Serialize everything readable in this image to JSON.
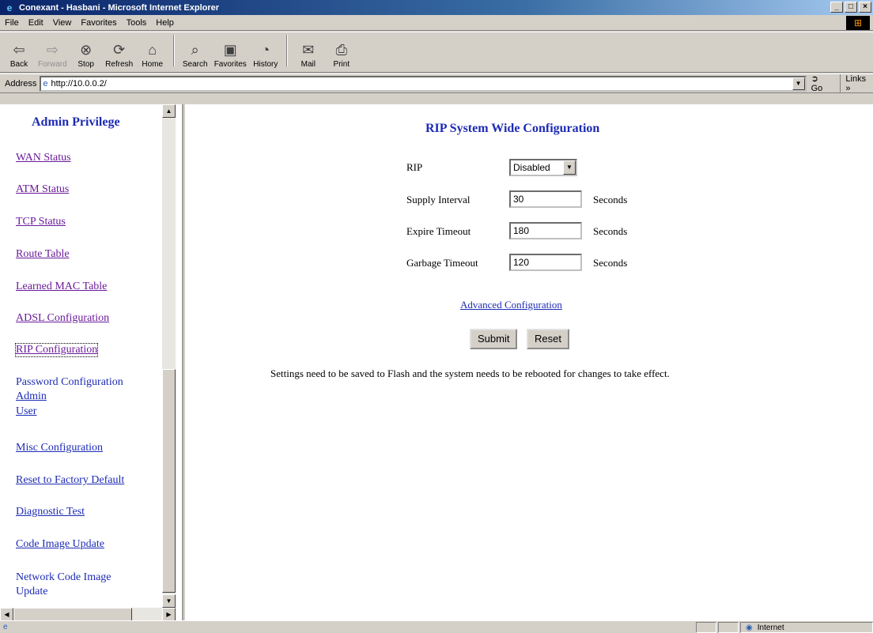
{
  "window": {
    "title": "Conexant - Hasbani - Microsoft Internet Explorer",
    "controls": [
      "_",
      "□",
      "×"
    ]
  },
  "menu": [
    "File",
    "Edit",
    "View",
    "Favorites",
    "Tools",
    "Help"
  ],
  "toolbar": {
    "back": "Back",
    "forward": "Forward",
    "stop": "Stop",
    "refresh": "Refresh",
    "home": "Home",
    "search": "Search",
    "favorites": "Favorites",
    "history": "History",
    "mail": "Mail",
    "print": "Print"
  },
  "address": {
    "label": "Address",
    "url": "http://10.0.0.2/",
    "go": "Go",
    "links": "Links »"
  },
  "sidebar": {
    "title": "Admin Privilege",
    "items": [
      {
        "label": "WAN Status"
      },
      {
        "label": "ATM Status"
      },
      {
        "label": "TCP Status"
      },
      {
        "label": "Route Table"
      },
      {
        "label": "Learned MAC Table"
      },
      {
        "label": "ADSL Configuration"
      },
      {
        "label": "RIP Configuration"
      },
      {
        "label": "Password Configuration"
      },
      {
        "label": "Admin"
      },
      {
        "label": "User"
      },
      {
        "label": "Misc Configuration"
      },
      {
        "label": "Reset to Factory Default"
      },
      {
        "label": "Diagnostic Test"
      },
      {
        "label": "Code Image Update"
      },
      {
        "label": "Network Code Image"
      },
      {
        "label": "Update"
      }
    ]
  },
  "main": {
    "heading": "RIP System Wide Configuration",
    "rip_label": "RIP",
    "rip_value": "Disabled",
    "supply_label": "Supply Interval",
    "supply_value": "30",
    "expire_label": "Expire Timeout",
    "expire_value": "180",
    "garbage_label": "Garbage Timeout",
    "garbage_value": "120",
    "unit": "Seconds",
    "advanced_link": "Advanced Configuration",
    "submit": "Submit",
    "reset": "Reset",
    "note": "Settings need to be saved to Flash and the system needs to be rebooted for changes to take effect."
  },
  "status": {
    "zone": "Internet"
  }
}
